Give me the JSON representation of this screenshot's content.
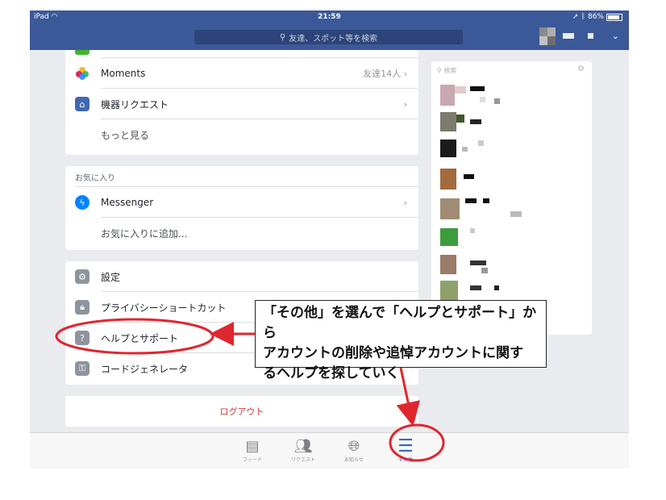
{
  "status_bar": {
    "device": "iPad",
    "time": "21:59",
    "battery": "86%"
  },
  "search": {
    "placeholder": "友達、スポット等を検索"
  },
  "menu": {
    "moments": {
      "label": "Moments",
      "detail": "友達14人"
    },
    "requests": {
      "label": "機器リクエスト"
    },
    "see_more": "もっと見る"
  },
  "favorites": {
    "header": "お気に入り",
    "messenger": {
      "label": "Messenger"
    },
    "add": "お気に入りに追加..."
  },
  "settings_card": {
    "settings": "設定",
    "privacy": "プライバシーショートカット",
    "help": "ヘルプとサポート",
    "code": "コードジェネレータ"
  },
  "logout": "ログアウト",
  "sidebar": {
    "search_placeholder": "検索"
  },
  "tabs": [
    {
      "label": "フィード",
      "icon": "feed-icon"
    },
    {
      "label": "リクエスト",
      "icon": "friends-icon"
    },
    {
      "label": "お知らせ",
      "icon": "globe-icon"
    },
    {
      "label": "その他",
      "icon": "menu-icon",
      "active": true
    }
  ],
  "annotation": {
    "line1": "「その他」を選んで「ヘルプとサポート」から",
    "line2": "アカウントの削除や追悼アカウントに関す",
    "line3": "るヘルプを探していく"
  },
  "colors": {
    "brand": "#3b5998",
    "annotation": "#e0262e",
    "logout": "#d9343a"
  }
}
